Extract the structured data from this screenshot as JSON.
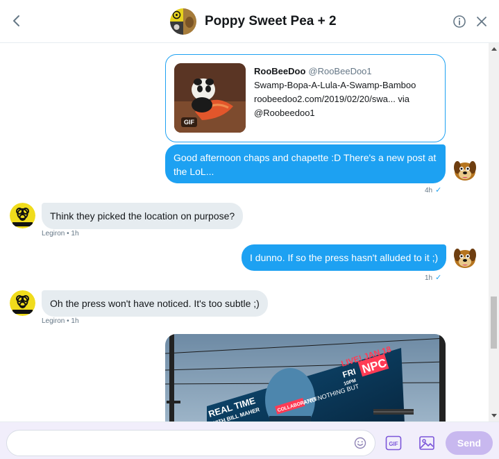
{
  "header": {
    "title": "Poppy Sweet Pea + 2",
    "back_icon": "chevron-left-icon",
    "info_icon": "info-icon",
    "close_icon": "close-icon"
  },
  "link_card": {
    "name": "RooBeeDoo",
    "handle": "@RooBeeDoo1",
    "line1": "Swamp-Bopa-A-Lula-A-Swamp-Bamboo",
    "line2": "roobeedoo2.com/2019/02/20/swa... via",
    "line3": "@Roobeedoo1",
    "gif_badge": "GIF"
  },
  "messages": [
    {
      "direction": "out",
      "text": "Good afternoon chaps and chapette :D There's a new post at the LoL...",
      "time": "4h",
      "status": "✓"
    },
    {
      "direction": "in",
      "text": "Think they picked the location on purpose?",
      "sender": "Legiron",
      "time": "1h"
    },
    {
      "direction": "out",
      "text": "I dunno. If so the press hasn't alluded to it ;)",
      "time": "1h",
      "status": "✓"
    },
    {
      "direction": "in",
      "text": "Oh the press won't have noticed. It's too subtle ;)",
      "sender": "Legiron",
      "time": "1h"
    }
  ],
  "billboard": {
    "live_text": "LIVE! JAN 18",
    "fri_text": "FRI",
    "time_text": "10PM",
    "npc_text": "NPC",
    "show_title": "REAL TIME",
    "show_subtitle": "WITH BILL MAHER",
    "slogan": "AND NOTHING BUT",
    "tag": "COLLABORATIVE"
  },
  "composer": {
    "placeholder": "",
    "value": "",
    "send_label": "Send",
    "gif_label": "GIF"
  },
  "colors": {
    "accent": "#1da1f2",
    "incoming_bubble": "#e6ecf0",
    "send_disabled": "#c8b8ef",
    "composer_bg": "#f1eefb"
  }
}
